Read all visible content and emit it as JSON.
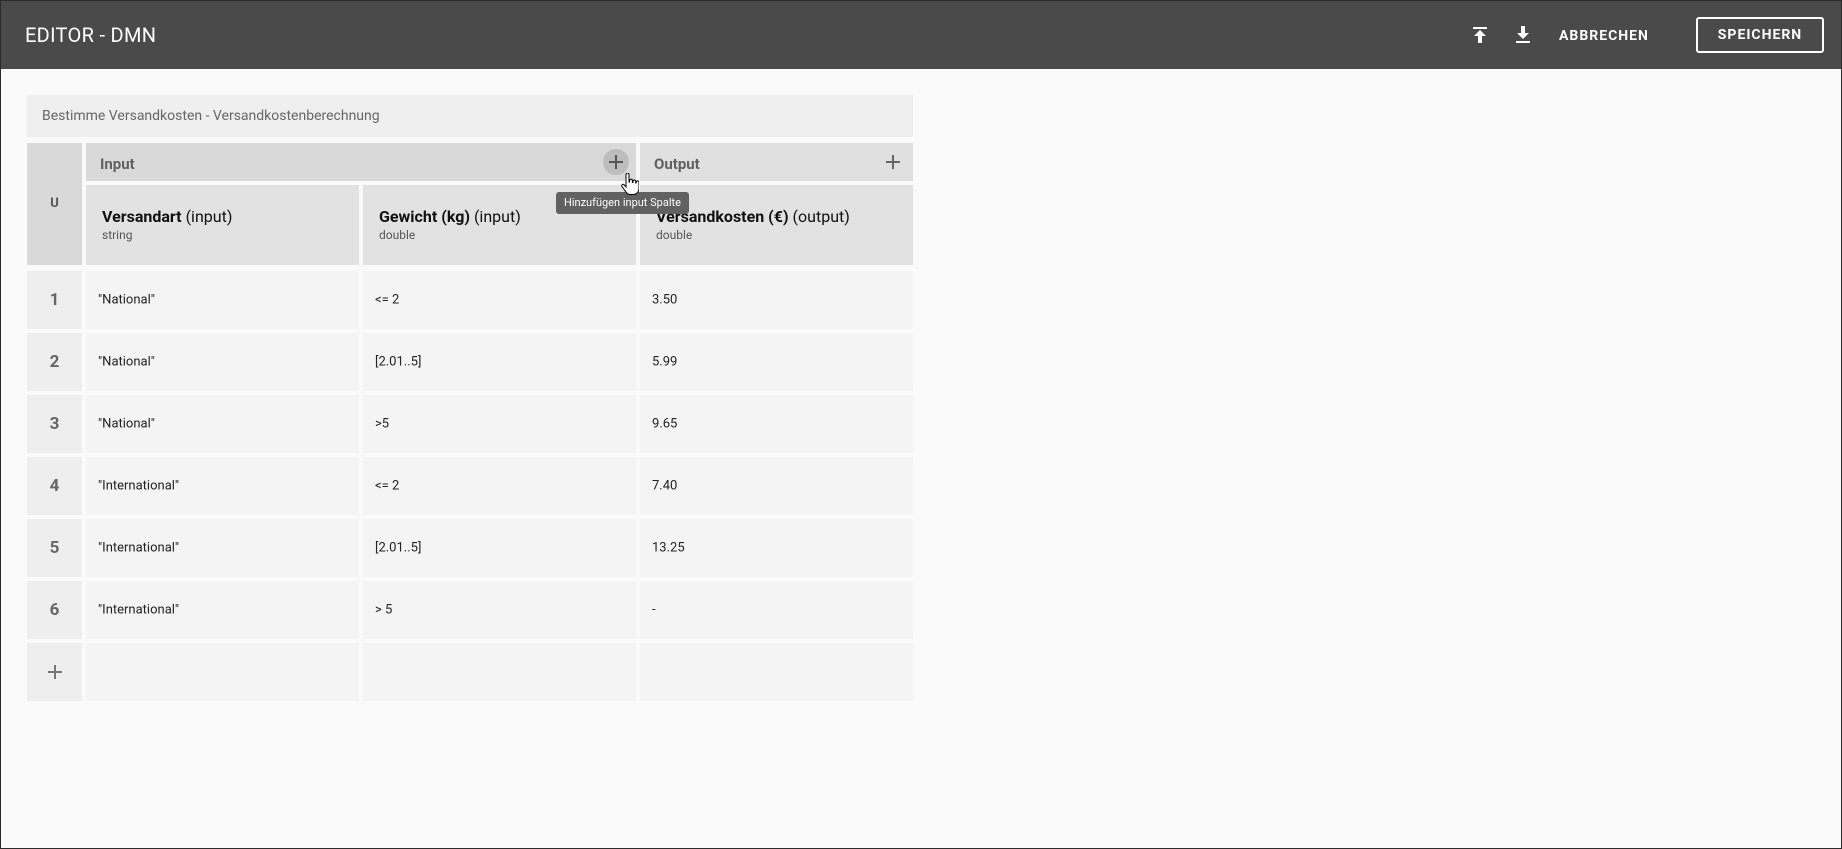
{
  "header": {
    "title": "EDITOR - DMN",
    "upload_icon": "upload-icon",
    "download_icon": "download-icon",
    "cancel_label": "ABBRECHEN",
    "save_label": "SPEICHERN"
  },
  "table": {
    "title": "Bestimme Versandkosten - Versandkostenberechnung",
    "hit_policy": "U",
    "input_section_label": "Input",
    "output_section_label": "Output",
    "add_input_tooltip": "Hinzufügen input Spalte",
    "columns": [
      {
        "name": "Versandart",
        "suffix": "(input)",
        "type": "string"
      },
      {
        "name": "Gewicht (kg)",
        "suffix": "(input)",
        "type": "double"
      },
      {
        "name": "Versandkosten (€)",
        "suffix": "(output)",
        "type": "double"
      }
    ],
    "rows": [
      {
        "num": "1",
        "c1": "\"National\"",
        "c2": "<= 2",
        "c3": "3.50"
      },
      {
        "num": "2",
        "c1": "\"National\"",
        "c2": "[2.01..5]",
        "c3": "5.99"
      },
      {
        "num": "3",
        "c1": "\"National\"",
        "c2": ">5",
        "c3": "9.65"
      },
      {
        "num": "4",
        "c1": "\"International\"",
        "c2": "<= 2",
        "c3": "7.40"
      },
      {
        "num": "5",
        "c1": "\"International\"",
        "c2": "[2.01..5]",
        "c3": "13.25"
      },
      {
        "num": "6",
        "c1": "\"International\"",
        "c2": "> 5",
        "c3": "-"
      }
    ]
  },
  "colors": {
    "topbar": "#4a4a4a",
    "background": "#fafafa",
    "header_cell": "#d9d9d9",
    "row_cell": "#f4f4f4"
  }
}
